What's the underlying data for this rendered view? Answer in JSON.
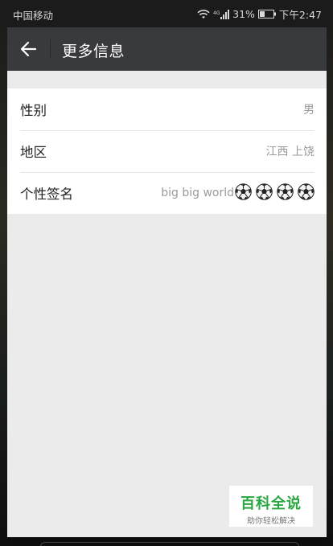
{
  "status_bar": {
    "carrier": "中国移动",
    "network": "4G",
    "battery": "31%",
    "time": "下午2:47"
  },
  "app_bar": {
    "title": "更多信息",
    "back_icon": "arrow-left-icon"
  },
  "info_rows": [
    {
      "label": "性别",
      "value": "男"
    },
    {
      "label": "地区",
      "value": "江西 上饶"
    },
    {
      "label": "个性签名",
      "value": "big big world",
      "emoji_count": 4,
      "emoji_icon": "soccer-ball-icon"
    }
  ],
  "watermark": {
    "title": "百科全说",
    "subtitle": "助你轻松解决"
  },
  "colors": {
    "app_bar": "#393a3e",
    "background": "#ebebeb",
    "watermark_green": "#29a63f"
  }
}
